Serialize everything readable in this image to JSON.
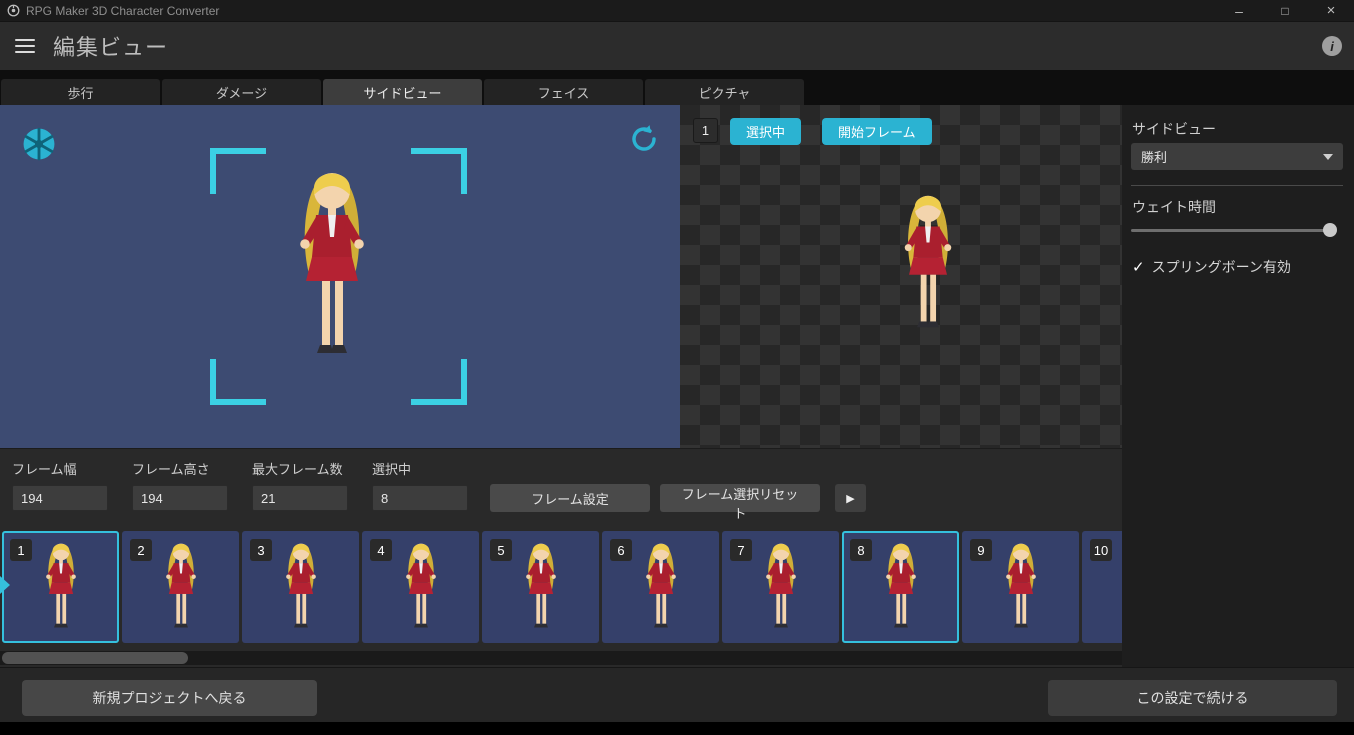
{
  "window": {
    "title": "RPG Maker 3D Character Converter",
    "minimize": "–",
    "maximize": "□",
    "close": "×"
  },
  "header": {
    "title": "編集ビュー",
    "info": "i"
  },
  "tabs": [
    {
      "label": "歩行",
      "active": false
    },
    {
      "label": "ダメージ",
      "active": false
    },
    {
      "label": "サイドビュー",
      "active": true
    },
    {
      "label": "フェイス",
      "active": false
    },
    {
      "label": "ピクチャ",
      "active": false
    }
  ],
  "stage": {
    "frame_badge": "1",
    "selected_button": "選択中",
    "start_frame_button": "開始フレーム"
  },
  "sidebar": {
    "title": "サイドビュー",
    "pose_value": "勝利",
    "wait_time_label": "ウェイト時間",
    "spring_bone_label": "スプリングボーン有効",
    "spring_bone_checked": true,
    "check_glyph": "✓"
  },
  "frame_panel": {
    "fields": [
      {
        "label": "フレーム幅",
        "value": "194"
      },
      {
        "label": "フレーム高さ",
        "value": "194"
      },
      {
        "label": "最大フレーム数",
        "value": "21"
      },
      {
        "label": "選択中",
        "value": "8"
      }
    ],
    "set_button": "フレーム設定",
    "reset_button": "フレーム選択リセット",
    "play_glyph": "▶"
  },
  "filmstrip": {
    "frames": [
      {
        "number": "1",
        "selected": true,
        "current": true
      },
      {
        "number": "2",
        "selected": false
      },
      {
        "number": "3",
        "selected": false
      },
      {
        "number": "4",
        "selected": false
      },
      {
        "number": "5",
        "selected": false
      },
      {
        "number": "6",
        "selected": false
      },
      {
        "number": "7",
        "selected": false
      },
      {
        "number": "8",
        "selected": true
      },
      {
        "number": "9",
        "selected": false
      },
      {
        "number": "10",
        "selected": false
      }
    ]
  },
  "footer": {
    "back_button": "新規プロジェクトへ戻る",
    "continue_button": "この設定で続ける"
  },
  "colors": {
    "accent": "#2bb3d2",
    "bracket": "#3bd0e4",
    "preview_bg": "#3d4b72"
  }
}
